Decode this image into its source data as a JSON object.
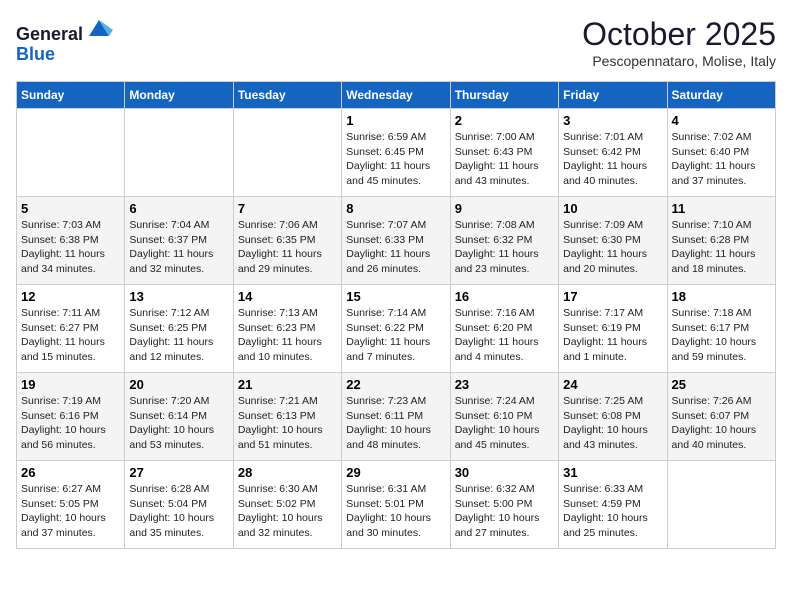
{
  "header": {
    "logo_general": "General",
    "logo_blue": "Blue",
    "month_title": "October 2025",
    "subtitle": "Pescopennataro, Molise, Italy"
  },
  "days_of_week": [
    "Sunday",
    "Monday",
    "Tuesday",
    "Wednesday",
    "Thursday",
    "Friday",
    "Saturday"
  ],
  "weeks": [
    [
      {
        "day": "",
        "info": ""
      },
      {
        "day": "",
        "info": ""
      },
      {
        "day": "",
        "info": ""
      },
      {
        "day": "1",
        "info": "Sunrise: 6:59 AM\nSunset: 6:45 PM\nDaylight: 11 hours\nand 45 minutes."
      },
      {
        "day": "2",
        "info": "Sunrise: 7:00 AM\nSunset: 6:43 PM\nDaylight: 11 hours\nand 43 minutes."
      },
      {
        "day": "3",
        "info": "Sunrise: 7:01 AM\nSunset: 6:42 PM\nDaylight: 11 hours\nand 40 minutes."
      },
      {
        "day": "4",
        "info": "Sunrise: 7:02 AM\nSunset: 6:40 PM\nDaylight: 11 hours\nand 37 minutes."
      }
    ],
    [
      {
        "day": "5",
        "info": "Sunrise: 7:03 AM\nSunset: 6:38 PM\nDaylight: 11 hours\nand 34 minutes."
      },
      {
        "day": "6",
        "info": "Sunrise: 7:04 AM\nSunset: 6:37 PM\nDaylight: 11 hours\nand 32 minutes."
      },
      {
        "day": "7",
        "info": "Sunrise: 7:06 AM\nSunset: 6:35 PM\nDaylight: 11 hours\nand 29 minutes."
      },
      {
        "day": "8",
        "info": "Sunrise: 7:07 AM\nSunset: 6:33 PM\nDaylight: 11 hours\nand 26 minutes."
      },
      {
        "day": "9",
        "info": "Sunrise: 7:08 AM\nSunset: 6:32 PM\nDaylight: 11 hours\nand 23 minutes."
      },
      {
        "day": "10",
        "info": "Sunrise: 7:09 AM\nSunset: 6:30 PM\nDaylight: 11 hours\nand 20 minutes."
      },
      {
        "day": "11",
        "info": "Sunrise: 7:10 AM\nSunset: 6:28 PM\nDaylight: 11 hours\nand 18 minutes."
      }
    ],
    [
      {
        "day": "12",
        "info": "Sunrise: 7:11 AM\nSunset: 6:27 PM\nDaylight: 11 hours\nand 15 minutes."
      },
      {
        "day": "13",
        "info": "Sunrise: 7:12 AM\nSunset: 6:25 PM\nDaylight: 11 hours\nand 12 minutes."
      },
      {
        "day": "14",
        "info": "Sunrise: 7:13 AM\nSunset: 6:23 PM\nDaylight: 11 hours\nand 10 minutes."
      },
      {
        "day": "15",
        "info": "Sunrise: 7:14 AM\nSunset: 6:22 PM\nDaylight: 11 hours\nand 7 minutes."
      },
      {
        "day": "16",
        "info": "Sunrise: 7:16 AM\nSunset: 6:20 PM\nDaylight: 11 hours\nand 4 minutes."
      },
      {
        "day": "17",
        "info": "Sunrise: 7:17 AM\nSunset: 6:19 PM\nDaylight: 11 hours\nand 1 minute."
      },
      {
        "day": "18",
        "info": "Sunrise: 7:18 AM\nSunset: 6:17 PM\nDaylight: 10 hours\nand 59 minutes."
      }
    ],
    [
      {
        "day": "19",
        "info": "Sunrise: 7:19 AM\nSunset: 6:16 PM\nDaylight: 10 hours\nand 56 minutes."
      },
      {
        "day": "20",
        "info": "Sunrise: 7:20 AM\nSunset: 6:14 PM\nDaylight: 10 hours\nand 53 minutes."
      },
      {
        "day": "21",
        "info": "Sunrise: 7:21 AM\nSunset: 6:13 PM\nDaylight: 10 hours\nand 51 minutes."
      },
      {
        "day": "22",
        "info": "Sunrise: 7:23 AM\nSunset: 6:11 PM\nDaylight: 10 hours\nand 48 minutes."
      },
      {
        "day": "23",
        "info": "Sunrise: 7:24 AM\nSunset: 6:10 PM\nDaylight: 10 hours\nand 45 minutes."
      },
      {
        "day": "24",
        "info": "Sunrise: 7:25 AM\nSunset: 6:08 PM\nDaylight: 10 hours\nand 43 minutes."
      },
      {
        "day": "25",
        "info": "Sunrise: 7:26 AM\nSunset: 6:07 PM\nDaylight: 10 hours\nand 40 minutes."
      }
    ],
    [
      {
        "day": "26",
        "info": "Sunrise: 6:27 AM\nSunset: 5:05 PM\nDaylight: 10 hours\nand 37 minutes."
      },
      {
        "day": "27",
        "info": "Sunrise: 6:28 AM\nSunset: 5:04 PM\nDaylight: 10 hours\nand 35 minutes."
      },
      {
        "day": "28",
        "info": "Sunrise: 6:30 AM\nSunset: 5:02 PM\nDaylight: 10 hours\nand 32 minutes."
      },
      {
        "day": "29",
        "info": "Sunrise: 6:31 AM\nSunset: 5:01 PM\nDaylight: 10 hours\nand 30 minutes."
      },
      {
        "day": "30",
        "info": "Sunrise: 6:32 AM\nSunset: 5:00 PM\nDaylight: 10 hours\nand 27 minutes."
      },
      {
        "day": "31",
        "info": "Sunrise: 6:33 AM\nSunset: 4:59 PM\nDaylight: 10 hours\nand 25 minutes."
      },
      {
        "day": "",
        "info": ""
      }
    ]
  ]
}
